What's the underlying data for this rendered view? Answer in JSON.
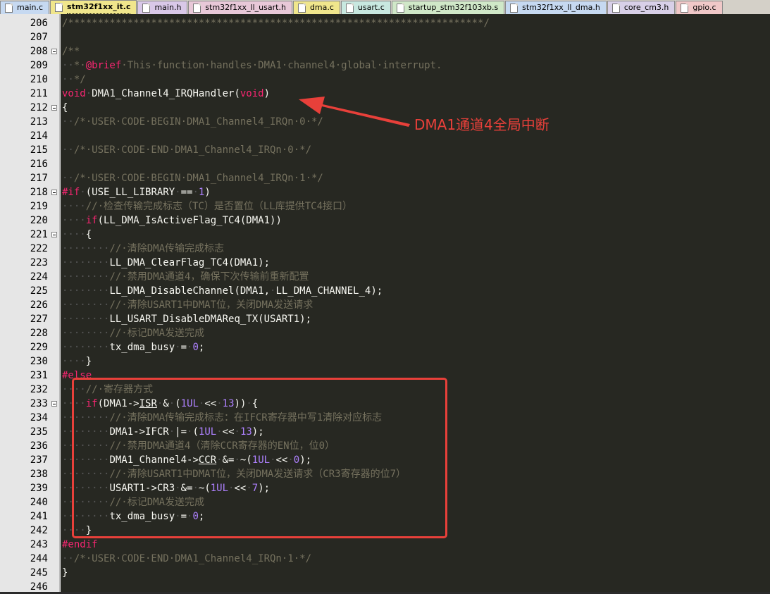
{
  "tabs": [
    {
      "label": "main.c",
      "color": "#c6d9f1",
      "active": false
    },
    {
      "label": "stm32f1xx_it.c",
      "color": "#f0e68c",
      "active": true
    },
    {
      "label": "main.h",
      "color": "#d9c8e8",
      "active": false
    },
    {
      "label": "stm32f1xx_ll_usart.h",
      "color": "#e8c8d8",
      "active": false
    },
    {
      "label": "dma.c",
      "color": "#f0e68c",
      "active": false
    },
    {
      "label": "usart.c",
      "color": "#c8e8e0",
      "active": false
    },
    {
      "label": "startup_stm32f103xb.s",
      "color": "#d0e8c8",
      "active": false
    },
    {
      "label": "stm32f1xx_ll_dma.h",
      "color": "#c6d9f1",
      "active": false
    },
    {
      "label": "core_cm3.h",
      "color": "#d8d0e8",
      "active": false
    },
    {
      "label": "gpio.c",
      "color": "#f0c8c8",
      "active": false
    }
  ],
  "annotation": {
    "label": "DMA1通道4全局中断",
    "color": "#e8403a"
  },
  "code_lines": [
    {
      "num": "206",
      "fold": false,
      "segs": [
        [
          "cm",
          "/**********************************************************************/"
        ]
      ]
    },
    {
      "num": "207",
      "fold": false,
      "segs": []
    },
    {
      "num": "208",
      "fold": true,
      "segs": [
        [
          "cm",
          "/**"
        ]
      ]
    },
    {
      "num": "209",
      "fold": false,
      "segs": [
        [
          "ws",
          "··"
        ],
        [
          "cm",
          "*·"
        ],
        [
          "kw",
          "@brief"
        ],
        [
          "cm",
          "·This·function·handles·DMA1·channel4·global·interrupt."
        ]
      ]
    },
    {
      "num": "210",
      "fold": false,
      "segs": [
        [
          "ws",
          "··"
        ],
        [
          "cm",
          "*/"
        ]
      ]
    },
    {
      "num": "211",
      "fold": false,
      "segs": [
        [
          "kw",
          "void"
        ],
        [
          "ws",
          "·"
        ],
        [
          "tx",
          "DMA1_Channel4_IRQHandler("
        ],
        [
          "kw",
          "void"
        ],
        [
          "tx",
          ")"
        ]
      ]
    },
    {
      "num": "212",
      "fold": true,
      "segs": [
        [
          "tx",
          "{"
        ]
      ]
    },
    {
      "num": "213",
      "fold": false,
      "segs": [
        [
          "ws",
          "··"
        ],
        [
          "cm",
          "/*·USER·CODE·BEGIN·DMA1_Channel4_IRQn·0·*/"
        ]
      ]
    },
    {
      "num": "214",
      "fold": false,
      "segs": []
    },
    {
      "num": "215",
      "fold": false,
      "segs": [
        [
          "ws",
          "··"
        ],
        [
          "cm",
          "/*·USER·CODE·END·DMA1_Channel4_IRQn·0·*/"
        ]
      ]
    },
    {
      "num": "216",
      "fold": false,
      "segs": []
    },
    {
      "num": "217",
      "fold": false,
      "segs": [
        [
          "ws",
          "··"
        ],
        [
          "cm",
          "/*·USER·CODE·BEGIN·DMA1_Channel4_IRQn·1·*/"
        ]
      ]
    },
    {
      "num": "218",
      "fold": true,
      "segs": [
        [
          "kw",
          "#if"
        ],
        [
          "ws",
          "·"
        ],
        [
          "tx",
          "(USE_LL_LIBRARY"
        ],
        [
          "ws",
          "·"
        ],
        [
          "tx",
          "=="
        ],
        [
          "ws",
          "·"
        ],
        [
          "nm",
          "1"
        ],
        [
          "tx",
          ")"
        ]
      ]
    },
    {
      "num": "219",
      "fold": false,
      "segs": [
        [
          "ws",
          "····"
        ],
        [
          "cm",
          "//·检查传输完成标志（TC）是否置位（LL库提供TC4接口）"
        ]
      ]
    },
    {
      "num": "220",
      "fold": false,
      "segs": [
        [
          "ws",
          "····"
        ],
        [
          "kw",
          "if"
        ],
        [
          "tx",
          "(LL_DMA_IsActiveFlag_TC4(DMA1))"
        ]
      ]
    },
    {
      "num": "221",
      "fold": true,
      "segs": [
        [
          "ws",
          "····"
        ],
        [
          "tx",
          "{"
        ]
      ]
    },
    {
      "num": "222",
      "fold": false,
      "segs": [
        [
          "ws",
          "········"
        ],
        [
          "cm",
          "//·清除DMA传输完成标志"
        ]
      ]
    },
    {
      "num": "223",
      "fold": false,
      "segs": [
        [
          "ws",
          "········"
        ],
        [
          "tx",
          "LL_DMA_ClearFlag_TC4(DMA1);"
        ]
      ]
    },
    {
      "num": "224",
      "fold": false,
      "segs": [
        [
          "ws",
          "········"
        ],
        [
          "cm",
          "//·禁用DMA通道4，确保下次传输前重新配置"
        ]
      ]
    },
    {
      "num": "225",
      "fold": false,
      "segs": [
        [
          "ws",
          "········"
        ],
        [
          "tx",
          "LL_DMA_DisableChannel(DMA1,"
        ],
        [
          "ws",
          "·"
        ],
        [
          "tx",
          "LL_DMA_CHANNEL_4);"
        ]
      ]
    },
    {
      "num": "226",
      "fold": false,
      "segs": [
        [
          "ws",
          "········"
        ],
        [
          "cm",
          "//·清除USART1中DMAT位，关闭DMA发送请求"
        ]
      ]
    },
    {
      "num": "227",
      "fold": false,
      "segs": [
        [
          "ws",
          "········"
        ],
        [
          "tx",
          "LL_USART_DisableDMAReq_TX(USART1);"
        ]
      ]
    },
    {
      "num": "228",
      "fold": false,
      "segs": [
        [
          "ws",
          "········"
        ],
        [
          "cm",
          "//·标记DMA发送完成"
        ]
      ]
    },
    {
      "num": "229",
      "fold": false,
      "segs": [
        [
          "ws",
          "········"
        ],
        [
          "tx",
          "tx_dma_busy"
        ],
        [
          "ws",
          "·"
        ],
        [
          "tx",
          "="
        ],
        [
          "ws",
          "·"
        ],
        [
          "nm",
          "0"
        ],
        [
          "tx",
          ";"
        ]
      ]
    },
    {
      "num": "230",
      "fold": false,
      "segs": [
        [
          "ws",
          "····"
        ],
        [
          "tx",
          "}"
        ]
      ]
    },
    {
      "num": "231",
      "fold": false,
      "segs": [
        [
          "kw",
          "#else"
        ]
      ]
    },
    {
      "num": "232",
      "fold": false,
      "segs": [
        [
          "ws",
          "····"
        ],
        [
          "cm",
          "//·寄存器方式"
        ]
      ]
    },
    {
      "num": "233",
      "fold": true,
      "segs": [
        [
          "ws",
          "····"
        ],
        [
          "kw",
          "if"
        ],
        [
          "tx",
          "(DMA1->"
        ],
        [
          "ul",
          "ISR"
        ],
        [
          "ws",
          "·"
        ],
        [
          "tx",
          "&"
        ],
        [
          "ws",
          "·"
        ],
        [
          "tx",
          "("
        ],
        [
          "nm",
          "1UL"
        ],
        [
          "ws",
          "·"
        ],
        [
          "tx",
          "<<"
        ],
        [
          "ws",
          "·"
        ],
        [
          "nm",
          "13"
        ],
        [
          "tx",
          "))"
        ],
        [
          "ws",
          "·"
        ],
        [
          "tx",
          "{"
        ]
      ]
    },
    {
      "num": "234",
      "fold": false,
      "segs": [
        [
          "ws",
          "········"
        ],
        [
          "cm",
          "//·清除DMA传输完成标志：在IFCR寄存器中写1清除对应标志"
        ]
      ]
    },
    {
      "num": "235",
      "fold": false,
      "segs": [
        [
          "ws",
          "········"
        ],
        [
          "tx",
          "DMA1->IFCR"
        ],
        [
          "ws",
          "·"
        ],
        [
          "tx",
          "|="
        ],
        [
          "ws",
          "·"
        ],
        [
          "tx",
          "("
        ],
        [
          "nm",
          "1UL"
        ],
        [
          "ws",
          "·"
        ],
        [
          "tx",
          "<<"
        ],
        [
          "ws",
          "·"
        ],
        [
          "nm",
          "13"
        ],
        [
          "tx",
          ");"
        ]
      ]
    },
    {
      "num": "236",
      "fold": false,
      "segs": [
        [
          "ws",
          "········"
        ],
        [
          "cm",
          "//·禁用DMA通道4（清除CCR寄存器的EN位，位0）"
        ]
      ]
    },
    {
      "num": "237",
      "fold": false,
      "segs": [
        [
          "ws",
          "········"
        ],
        [
          "tx",
          "DMA1_Channel4->"
        ],
        [
          "ul",
          "CCR"
        ],
        [
          "ws",
          "·"
        ],
        [
          "tx",
          "&="
        ],
        [
          "ws",
          "·"
        ],
        [
          "tx",
          "~("
        ],
        [
          "nm",
          "1UL"
        ],
        [
          "ws",
          "·"
        ],
        [
          "tx",
          "<<"
        ],
        [
          "ws",
          "·"
        ],
        [
          "nm",
          "0"
        ],
        [
          "tx",
          ");"
        ]
      ]
    },
    {
      "num": "238",
      "fold": false,
      "segs": [
        [
          "ws",
          "········"
        ],
        [
          "cm",
          "//·清除USART1中DMAT位，关闭DMA发送请求（CR3寄存器的位7）"
        ]
      ]
    },
    {
      "num": "239",
      "fold": false,
      "segs": [
        [
          "ws",
          "········"
        ],
        [
          "tx",
          "USART1->CR3"
        ],
        [
          "ws",
          "·"
        ],
        [
          "tx",
          "&="
        ],
        [
          "ws",
          "·"
        ],
        [
          "tx",
          "~("
        ],
        [
          "nm",
          "1UL"
        ],
        [
          "ws",
          "·"
        ],
        [
          "tx",
          "<<"
        ],
        [
          "ws",
          "·"
        ],
        [
          "nm",
          "7"
        ],
        [
          "tx",
          ");"
        ]
      ]
    },
    {
      "num": "240",
      "fold": false,
      "segs": [
        [
          "ws",
          "········"
        ],
        [
          "cm",
          "//·标记DMA发送完成"
        ]
      ]
    },
    {
      "num": "241",
      "fold": false,
      "segs": [
        [
          "ws",
          "········"
        ],
        [
          "tx",
          "tx_dma_busy"
        ],
        [
          "ws",
          "·"
        ],
        [
          "tx",
          "="
        ],
        [
          "ws",
          "·"
        ],
        [
          "nm",
          "0"
        ],
        [
          "tx",
          ";"
        ]
      ]
    },
    {
      "num": "242",
      "fold": false,
      "segs": [
        [
          "ws",
          "····"
        ],
        [
          "tx",
          "}"
        ]
      ]
    },
    {
      "num": "243",
      "fold": false,
      "segs": [
        [
          "kw",
          "#endif"
        ]
      ]
    },
    {
      "num": "244",
      "fold": false,
      "segs": [
        [
          "ws",
          "··"
        ],
        [
          "cm",
          "/*·USER·CODE·END·DMA1_Channel4_IRQn·1·*/"
        ]
      ]
    },
    {
      "num": "245",
      "fold": false,
      "segs": [
        [
          "tx",
          "}"
        ]
      ]
    },
    {
      "num": "246",
      "fold": false,
      "segs": []
    }
  ]
}
